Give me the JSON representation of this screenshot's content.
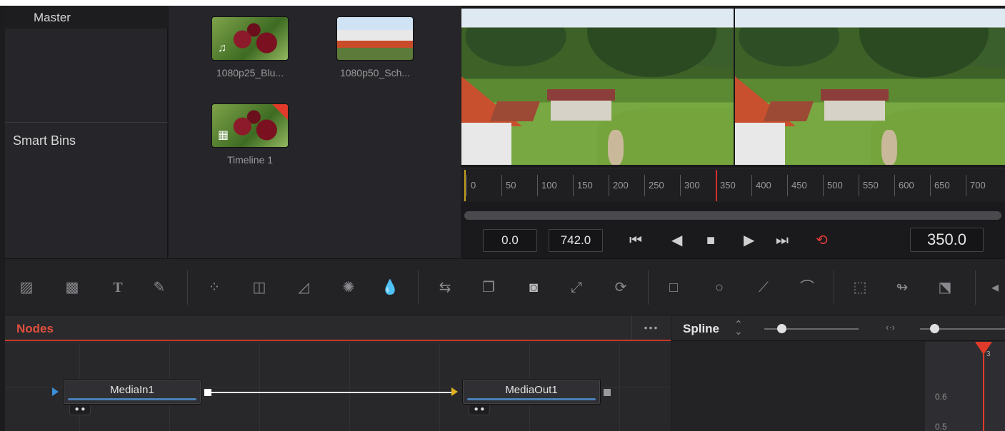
{
  "bins": {
    "master": "Master",
    "smart_bins": "Smart Bins"
  },
  "media_pool": {
    "clips": [
      {
        "label": "1080p25_Blu...",
        "icon": "music-note-icon"
      },
      {
        "label": "1080p50_Sch...",
        "icon": "none"
      },
      {
        "label": "Timeline 1",
        "icon": "timeline-icon"
      }
    ]
  },
  "ruler": {
    "ticks": [
      "0",
      "50",
      "100",
      "150",
      "200",
      "250",
      "300",
      "350",
      "400",
      "450",
      "500",
      "550",
      "600",
      "650",
      "700"
    ]
  },
  "transport": {
    "start": "0.0",
    "end": "742.0",
    "current": "350.0",
    "loop_color": "#e23b3b"
  },
  "nodes": {
    "title": "Nodes",
    "more": "•••",
    "items": [
      {
        "name": "MediaIn1"
      },
      {
        "name": "MediaOut1"
      }
    ]
  },
  "spline": {
    "title": "Spline",
    "graph_labels": [
      "0.6",
      "0.5"
    ],
    "playhead_label": "3"
  },
  "colors": {
    "accent": "#e03a2a",
    "link": "#4a80b8"
  }
}
